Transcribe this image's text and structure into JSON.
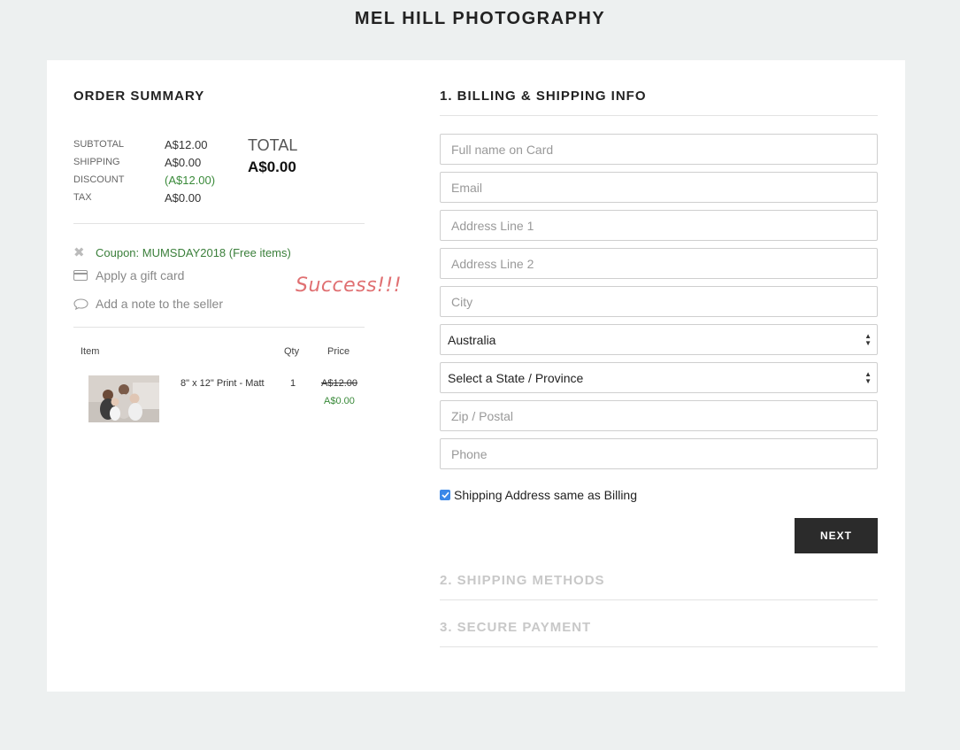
{
  "site": {
    "title": "MEL HILL PHOTOGRAPHY"
  },
  "summary": {
    "title": "ORDER SUMMARY",
    "rows": [
      {
        "label": "SUBTOTAL",
        "value": "A$12.00"
      },
      {
        "label": "SHIPPING",
        "value": "A$0.00"
      },
      {
        "label": "DISCOUNT",
        "value": "(A$12.00)"
      },
      {
        "label": "TAX",
        "value": "A$0.00"
      }
    ],
    "total_label": "TOTAL",
    "total_value": "A$0.00",
    "coupon": "Coupon: MUMSDAY2018 (Free items)",
    "gift_card": "Apply a gift card",
    "note": "Add a note to the seller",
    "success": "Success!!!",
    "table": {
      "headers": {
        "item": "Item",
        "qty": "Qty",
        "price": "Price"
      },
      "item": {
        "name": "8\" x 12\" Print - Matt",
        "qty": "1",
        "old_price": "A$12.00",
        "new_price": "A$0.00"
      }
    }
  },
  "billing": {
    "title": "1. BILLING & SHIPPING INFO",
    "fields": {
      "full_name": "Full name on Card",
      "email": "Email",
      "address1": "Address Line 1",
      "address2": "Address Line 2",
      "city": "City",
      "zip": "Zip / Postal",
      "phone": "Phone"
    },
    "country": "Australia",
    "state": "Select a State / Province",
    "same_address": "Shipping Address same as Billing",
    "next": "NEXT"
  },
  "steps": {
    "shipping": "2. SHIPPING METHODS",
    "payment": "3. SECURE PAYMENT"
  },
  "colors": {
    "accent_green": "#3a8a3a",
    "success_pink": "#e07072",
    "checkbox_blue": "#3b88e8",
    "button_dark": "#2b2b2b"
  }
}
